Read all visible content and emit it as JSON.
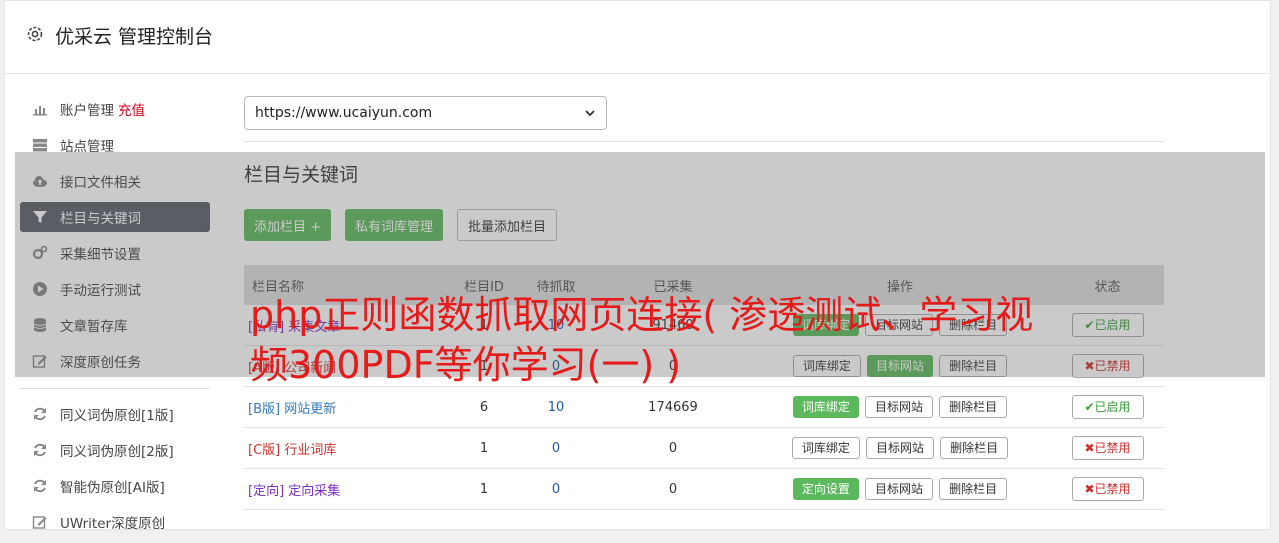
{
  "header": {
    "title": "优采云 管理控制台"
  },
  "sidebar": {
    "items": [
      {
        "label": "账户管理",
        "extra": "充值",
        "icon": "bar-chart-icon"
      },
      {
        "label": "站点管理",
        "icon": "server-icon"
      },
      {
        "label": "接口文件相关",
        "icon": "cloud-upload-icon"
      },
      {
        "label": "栏目与关键词",
        "icon": "filter-icon",
        "active": true
      },
      {
        "label": "采集细节设置",
        "icon": "gears-icon"
      },
      {
        "label": "手动运行测试",
        "icon": "play-icon"
      },
      {
        "label": "文章暂存库",
        "icon": "database-icon"
      },
      {
        "label": "深度原创任务",
        "icon": "edit-icon"
      }
    ],
    "items2": [
      {
        "label": "同义词伪原创[1版]",
        "icon": "refresh-icon"
      },
      {
        "label": "同义词伪原创[2版]",
        "icon": "refresh-icon"
      },
      {
        "label": "智能伪原创[AI版]",
        "icon": "refresh-icon"
      },
      {
        "label": "UWriter深度原创",
        "icon": "edit-icon"
      }
    ]
  },
  "main": {
    "site_select": "https://www.ucaiyun.com",
    "section_title": "栏目与关键词",
    "buttons": {
      "add_column": "添加栏目 +",
      "private_lib": "私有词库管理",
      "batch_add": "批量添加栏目"
    },
    "table": {
      "headers": [
        "栏目名称",
        "栏目ID",
        "待抓取",
        "已采集",
        "操作",
        "状态"
      ],
      "rows": [
        {
          "tag": "[私有]",
          "name": "采集文章",
          "id": "1",
          "pending": "10",
          "collected": "91460",
          "op1": "词库绑定",
          "op2": "目标网站",
          "op3": "删除栏目",
          "status": "✔已启用"
        },
        {
          "tag": "[A版]",
          "name": "公司新闻",
          "id": "1",
          "pending": "0",
          "collected": "0",
          "op1": "词库绑定",
          "op2": "目标网站",
          "op3": "删除栏目",
          "status": "✖已禁用"
        },
        {
          "tag": "[B版]",
          "name": "网站更新",
          "id": "6",
          "pending": "10",
          "collected": "174669",
          "op1": "词库绑定",
          "op2": "目标网站",
          "op3": "删除栏目",
          "status": "✔已启用"
        },
        {
          "tag": "[C版]",
          "name": "行业词库",
          "id": "1",
          "pending": "0",
          "collected": "0",
          "op1": "词库绑定",
          "op2": "目标网站",
          "op3": "删除栏目",
          "status": "✖已禁用"
        },
        {
          "tag": "[定向]",
          "name": "定向采集",
          "id": "1",
          "pending": "0",
          "collected": "0",
          "op1": "定向设置",
          "op2": "目标网站",
          "op3": "删除栏目",
          "status": "✖已禁用"
        }
      ]
    }
  },
  "overlay_caption": "php正则函数抓取网页连接( 渗透测试、学习视频300PDF等你学习(一) )"
}
